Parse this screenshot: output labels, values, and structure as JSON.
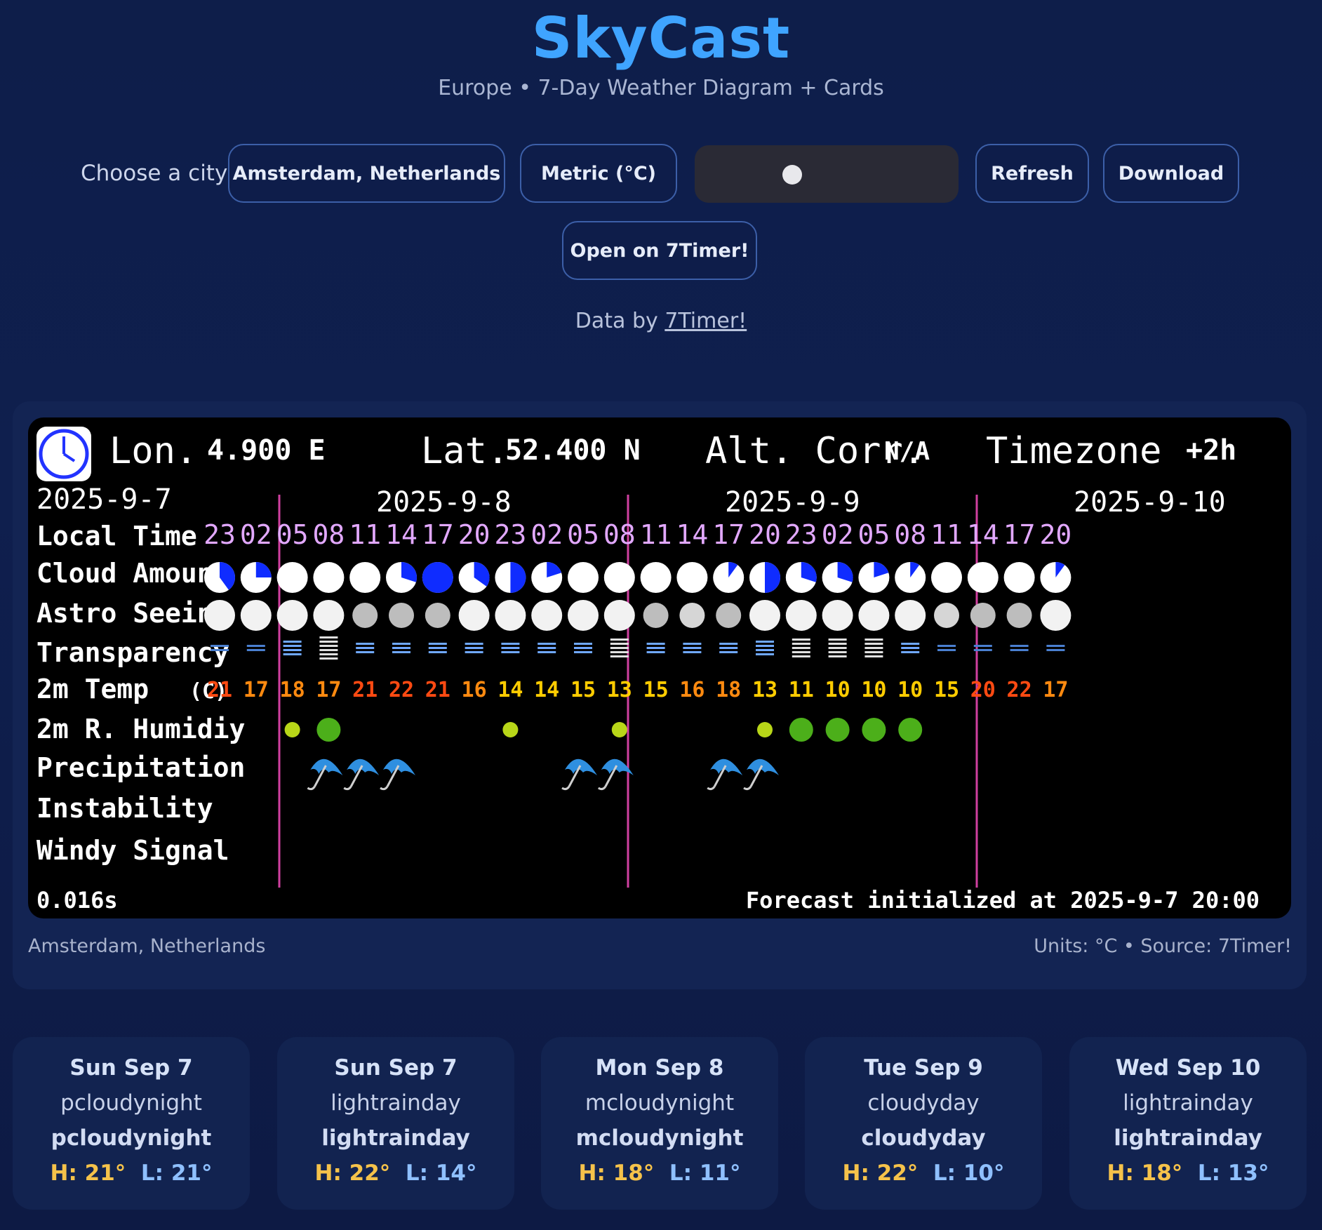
{
  "app": {
    "title": "SkyCast",
    "subtitle": "Europe • 7-Day Weather Diagram + Cards"
  },
  "controls": {
    "choose_label": "Choose a city",
    "city": "Amsterdam, Netherlands",
    "units": "Metric (°C)",
    "refresh": "Refresh",
    "download": "Download",
    "open_link": "Open on 7Timer!"
  },
  "credit": {
    "prefix": "Data by",
    "link": "7Timer!"
  },
  "diagram": {
    "lon_label": "Lon.",
    "lon_value": "4.900 E",
    "lat_label": "Lat.",
    "lat_value": "52.400 N",
    "alt_label": "Alt. Corr.",
    "alt_value": "N/A",
    "tz_label": "Timezone",
    "tz_value": "+2h",
    "dates": [
      "2025-9-7",
      "2025-9-8",
      "2025-9-9",
      "2025-9-10"
    ],
    "row_labels": [
      "Local Time",
      "Cloud Amount",
      "Astro Seeing",
      "Transparency",
      "2m Temp",
      "2m R. Humidiy",
      "Precipitation",
      "Instability",
      "Windy Signal"
    ],
    "temp_unit": "(C)",
    "times": [
      "23",
      "02",
      "05",
      "08",
      "11",
      "14",
      "17",
      "20",
      "23",
      "02",
      "05",
      "08",
      "11",
      "14",
      "17",
      "20",
      "23",
      "02",
      "05",
      "08",
      "11",
      "14",
      "17",
      "20"
    ],
    "cloud_fraction": [
      0.4,
      0.25,
      0,
      0,
      0,
      0.3,
      1,
      0.35,
      0.5,
      0.2,
      0,
      0,
      0,
      0,
      0.1,
      0.5,
      0.3,
      0.3,
      0.2,
      0.1,
      0,
      0,
      0,
      0.1
    ],
    "seeing_level": [
      "w",
      "w",
      "w",
      "w",
      "g",
      "g",
      "g",
      "w",
      "w",
      "w",
      "w",
      "w",
      "g",
      "lg",
      "g",
      "w",
      "w",
      "w",
      "w",
      "w",
      "lg",
      "g",
      "g",
      "w"
    ],
    "transparency_bars": [
      2,
      2,
      4,
      6,
      3,
      3,
      3,
      3,
      3,
      3,
      3,
      5,
      3,
      3,
      3,
      4,
      5,
      5,
      5,
      3,
      2,
      2,
      2,
      2
    ],
    "temps": [
      21,
      17,
      18,
      17,
      21,
      22,
      21,
      16,
      14,
      14,
      15,
      13,
      15,
      16,
      18,
      13,
      11,
      10,
      10,
      10,
      15,
      20,
      22,
      17
    ],
    "humidity_dot": [
      0,
      0,
      1,
      2,
      0,
      0,
      0,
      0,
      1,
      0,
      0,
      1,
      0,
      0,
      0,
      1,
      2,
      2,
      2,
      2,
      0,
      0,
      0,
      0
    ],
    "precip": [
      0,
      0,
      0,
      1,
      1,
      1,
      0,
      0,
      0,
      0,
      1,
      1,
      0,
      0,
      1,
      1,
      0,
      0,
      0,
      0,
      0,
      0,
      0,
      0
    ],
    "timing": "0.016s",
    "init_text": "Forecast initialized at 2025-9-7  20:00"
  },
  "panel_footer": {
    "location": "Amsterdam, Netherlands",
    "units_source": "Units: °C • Source: 7Timer!"
  },
  "cards": [
    {
      "date": "Sun Sep 7",
      "cond": "pcloudynight",
      "cond_bold": "pcloudynight",
      "high": "H: 21°",
      "low": "L: 21°"
    },
    {
      "date": "Sun Sep 7",
      "cond": "lightrainday",
      "cond_bold": "lightrainday",
      "high": "H: 22°",
      "low": "L: 14°"
    },
    {
      "date": "Mon Sep 8",
      "cond": "mcloudynight",
      "cond_bold": "mcloudynight",
      "high": "H: 18°",
      "low": "L: 11°"
    },
    {
      "date": "Tue Sep 9",
      "cond": "cloudyday",
      "cond_bold": "cloudyday",
      "high": "H: 22°",
      "low": "L: 10°"
    },
    {
      "date": "Wed Sep 10",
      "cond": "lightrainday",
      "cond_bold": "lightrainday",
      "high": "H: 18°",
      "low": "L: 13°"
    }
  ],
  "colors": {
    "accent": "#3fa4ff",
    "time_label": "#e2a8ff",
    "day_divider": "#d040a0",
    "cloud_fill": "#0f2cff",
    "humidity_dot": "#b8d618",
    "humidity_dot_big": "#4caf1a"
  }
}
